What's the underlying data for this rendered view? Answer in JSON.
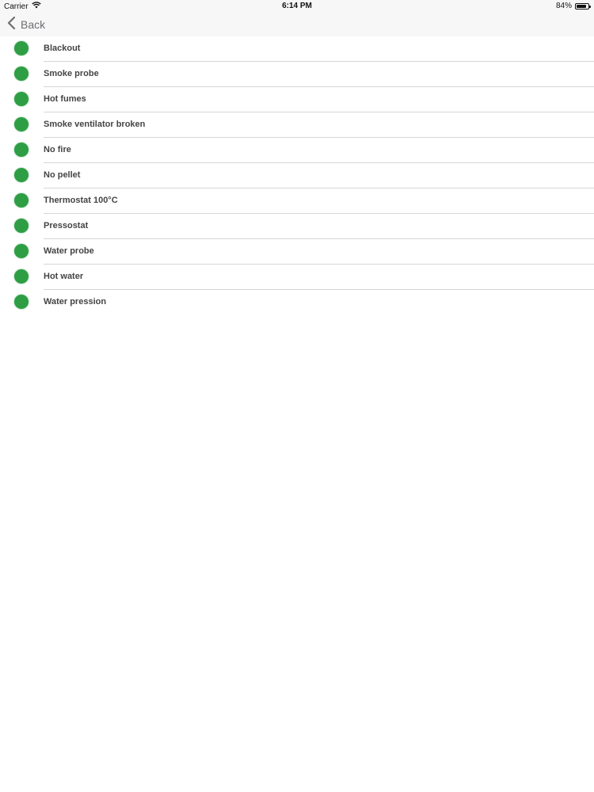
{
  "status_bar": {
    "carrier": "Carrier",
    "time": "6:14 PM",
    "battery": "84%",
    "battery_level": 0.84
  },
  "nav": {
    "back_label": "Back"
  },
  "alarms": {
    "items": [
      {
        "label": "Blackout",
        "status_color": "#2e9e44"
      },
      {
        "label": "Smoke probe",
        "status_color": "#2e9e44"
      },
      {
        "label": "Hot fumes",
        "status_color": "#2e9e44"
      },
      {
        "label": "Smoke ventilator broken",
        "status_color": "#2e9e44"
      },
      {
        "label": "No fire",
        "status_color": "#2e9e44"
      },
      {
        "label": "No pellet",
        "status_color": "#2e9e44"
      },
      {
        "label": "Thermostat 100°C",
        "status_color": "#2e9e44"
      },
      {
        "label": "Pressostat",
        "status_color": "#2e9e44"
      },
      {
        "label": "Water probe",
        "status_color": "#2e9e44"
      },
      {
        "label": "Hot water",
        "status_color": "#2e9e44"
      },
      {
        "label": "Water pression",
        "status_color": "#2e9e44"
      }
    ]
  }
}
